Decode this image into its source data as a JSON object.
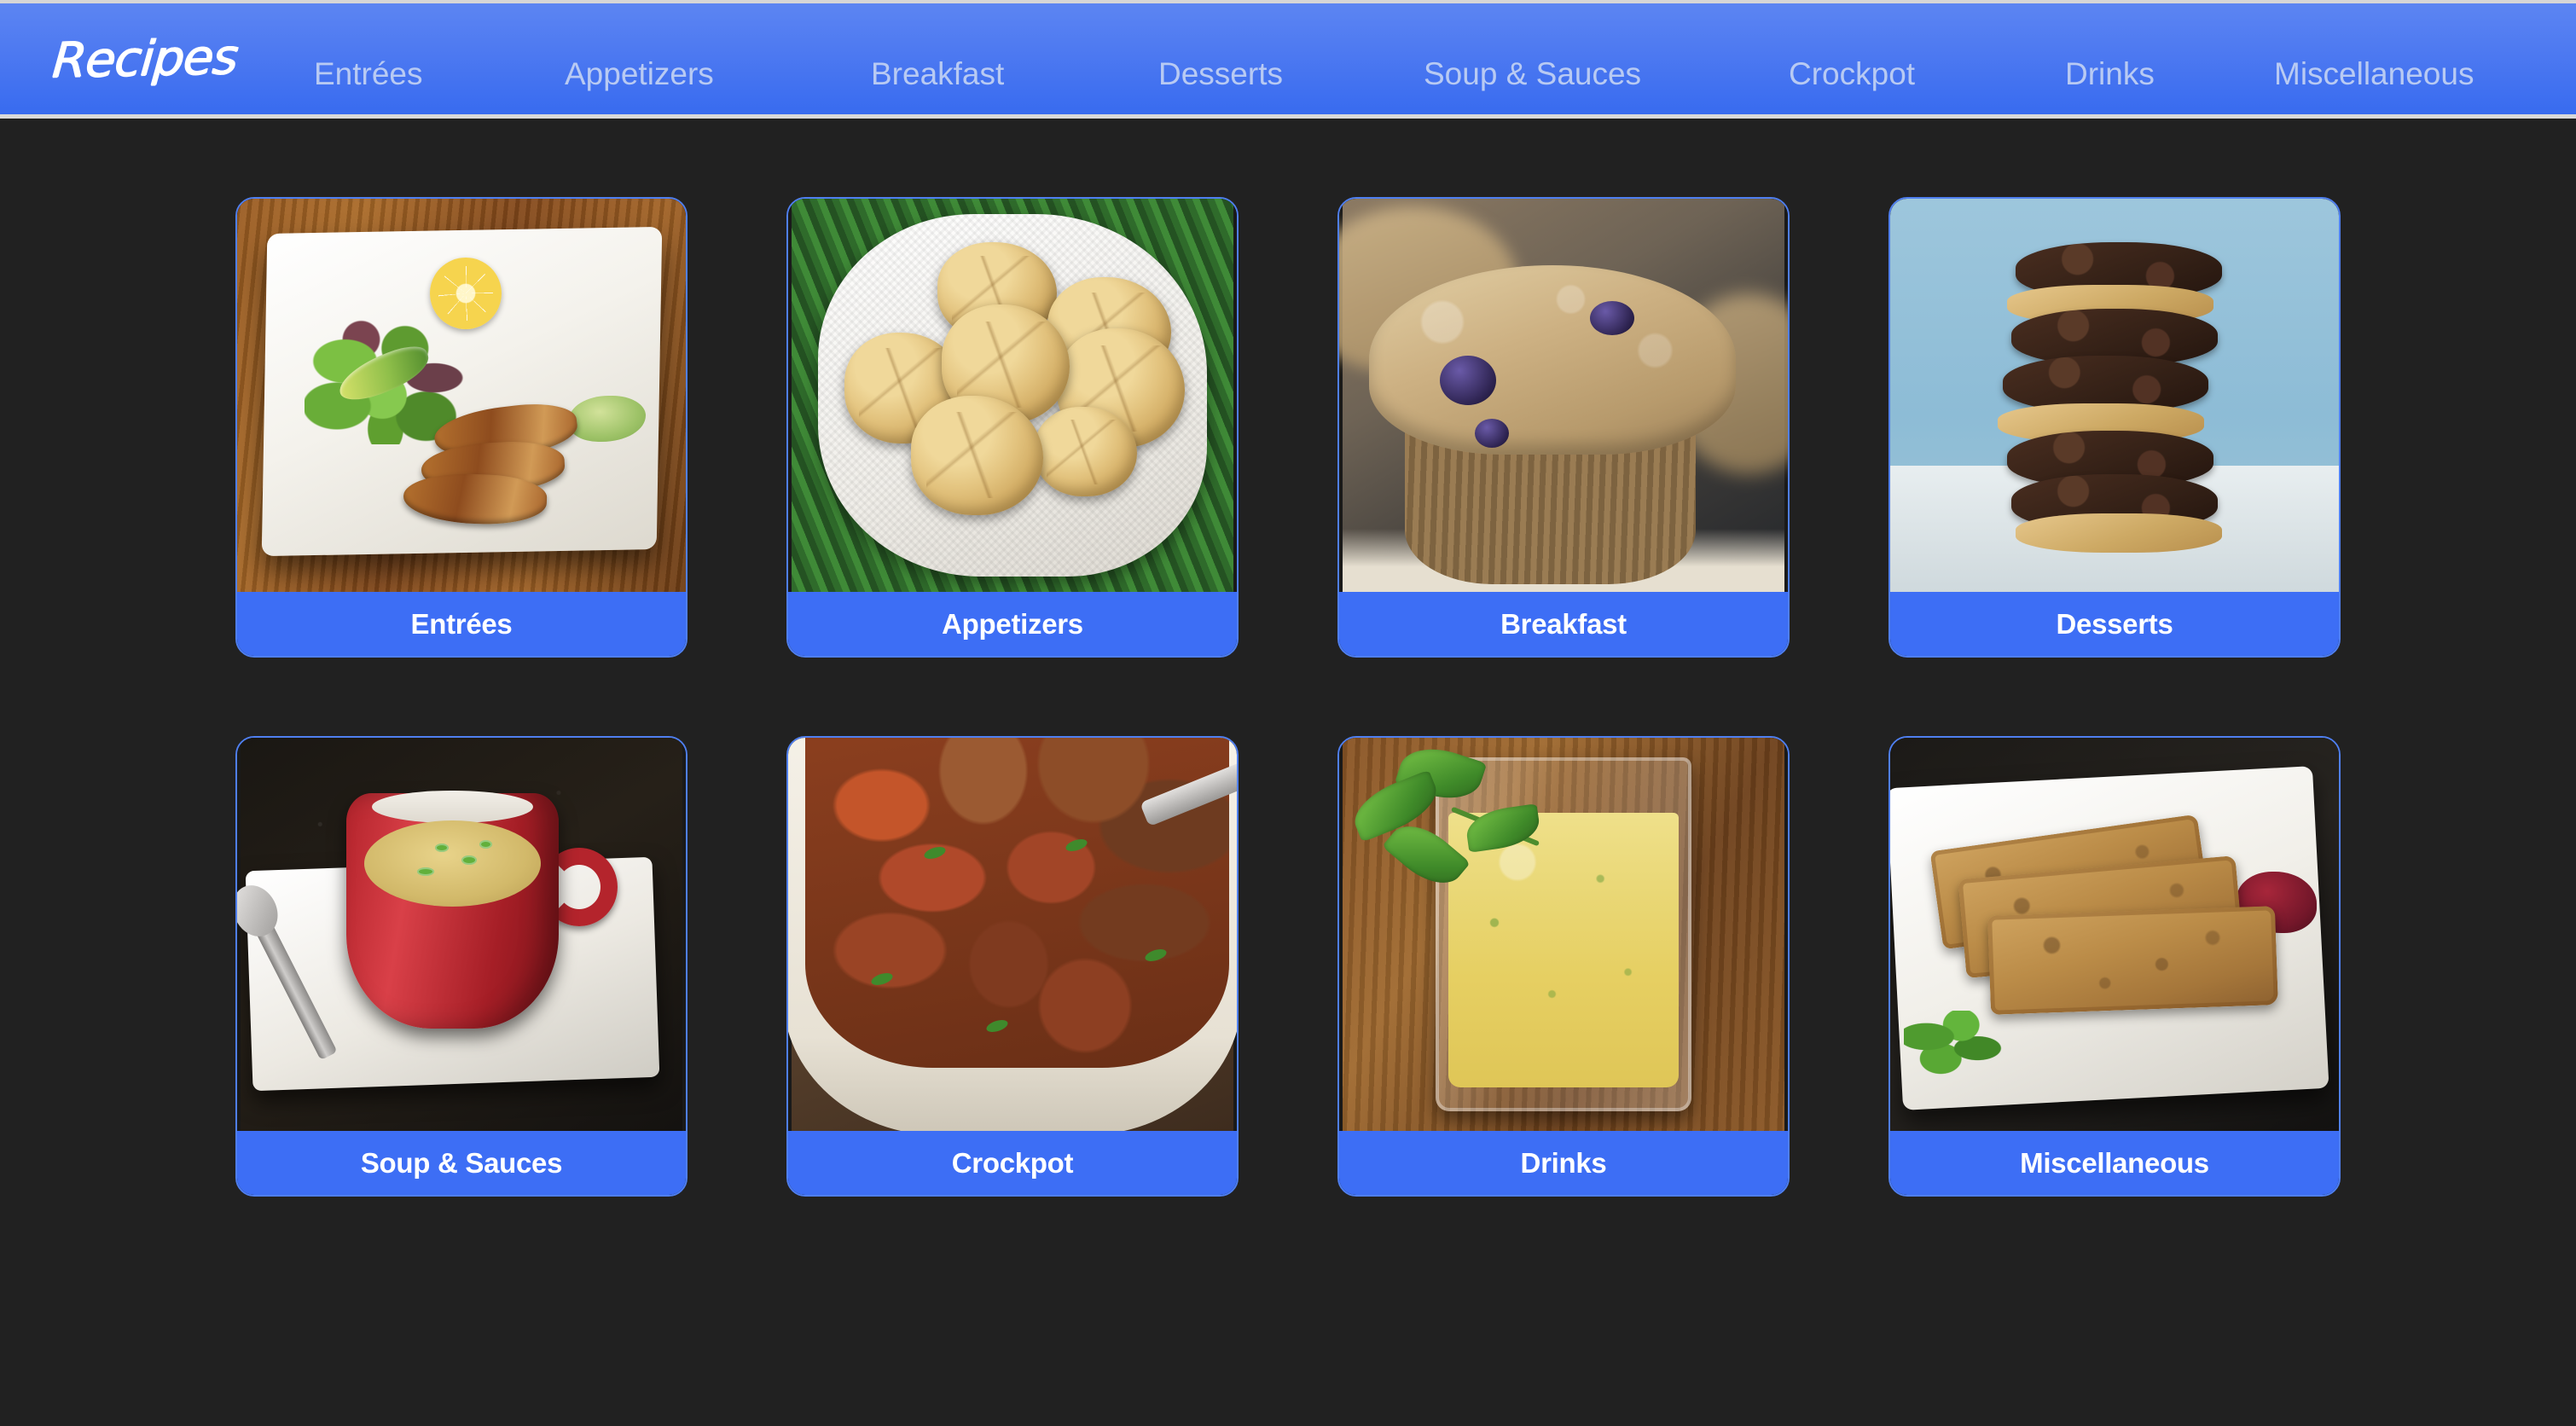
{
  "header": {
    "brand": "Recipes",
    "nav_items": [
      {
        "label": "Entrées"
      },
      {
        "label": "Appetizers"
      },
      {
        "label": "Breakfast"
      },
      {
        "label": "Desserts"
      },
      {
        "label": "Soup & Sauces"
      },
      {
        "label": "Crockpot"
      },
      {
        "label": "Drinks"
      },
      {
        "label": "Miscellaneous"
      }
    ],
    "colors": {
      "bar_top": "#5c85f2",
      "bar_bottom": "#386bef",
      "border": "#d9d9d9",
      "brand_text": "#ffffff",
      "nav_text": "#b8caf3"
    }
  },
  "page": {
    "background": "#212121"
  },
  "grid": {
    "columns": 4,
    "rows": 2,
    "card_border_color": "#4f7ff0",
    "card_label_color": "#3d6ef5",
    "card_label_text_color": "#ffffff",
    "cards": [
      {
        "label": "Entrées",
        "photo_alt": "blackened fish fillets with mixed green salad, avocado slices, lemon half and avocado crema on a white square plate set on a wooden table"
      },
      {
        "label": "Appetizers",
        "photo_alt": "pile of golden jalapeño cheddar drop biscuits on white paper towels inside a green woven basket"
      },
      {
        "label": "Breakfast",
        "photo_alt": "close-up of a blueberry streusel muffin in a paper liner with more muffins blurred behind"
      },
      {
        "label": "Desserts",
        "photo_alt": "stack of chocolate whoopie pie cookies filled with peanut butter cream against a light blue background"
      },
      {
        "label": "Soup & Sauces",
        "photo_alt": "red ceramic mug of creamy soup garnished with sliced scallions on a white square plate with a spoon on dark granite"
      },
      {
        "label": "Crockpot",
        "photo_alt": "white bowl of slow-cooker beef chili with tomatoes, sweet potato chunks and chopped cilantro"
      },
      {
        "label": "Drinks",
        "photo_alt": "glass tumbler of pale yellow mango smoothie garnished with a fresh mint sprig on a wooden table"
      },
      {
        "label": "Miscellaneous",
        "photo_alt": "three slices of banana bread on a white plate with cilantro garnish and a spoonful of cranberry sauce"
      }
    ]
  }
}
